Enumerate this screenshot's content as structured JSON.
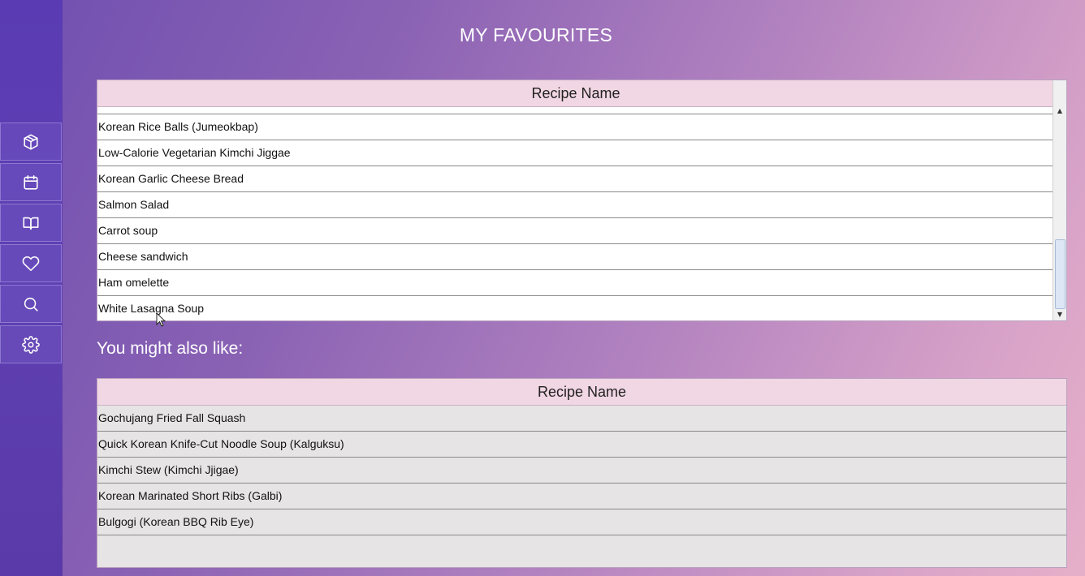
{
  "page_title": "MY FAVOURITES",
  "sidebar": {
    "items": [
      {
        "icon": "box-icon"
      },
      {
        "icon": "calendar-icon"
      },
      {
        "icon": "book-icon"
      },
      {
        "icon": "heart-icon"
      },
      {
        "icon": "search-icon"
      },
      {
        "icon": "settings-icon"
      }
    ]
  },
  "favourites": {
    "column_header": "Recipe Name",
    "rows": [
      "Korean Rice Balls (Jumeokbap)",
      "Low-Calorie Vegetarian Kimchi Jiggae",
      "Korean Garlic Cheese Bread",
      "Salmon Salad",
      "Carrot soup",
      "Cheese sandwich",
      "Ham omelette",
      "White Lasagna Soup"
    ]
  },
  "suggestions": {
    "title": "You might also like:",
    "column_header": "Recipe Name",
    "rows": [
      "Gochujang Fried Fall Squash",
      "Quick Korean Knife-Cut Noodle Soup (Kalguksu)",
      "Kimchi Stew (Kimchi Jjigae)",
      "Korean Marinated Short Ribs (Galbi)",
      "Bulgogi (Korean BBQ Rib Eye)"
    ]
  },
  "colors": {
    "sidebar": "#5f40b2",
    "header_bg": "#f1d6e3",
    "suggestion_row_bg": "#e6e4e4"
  }
}
